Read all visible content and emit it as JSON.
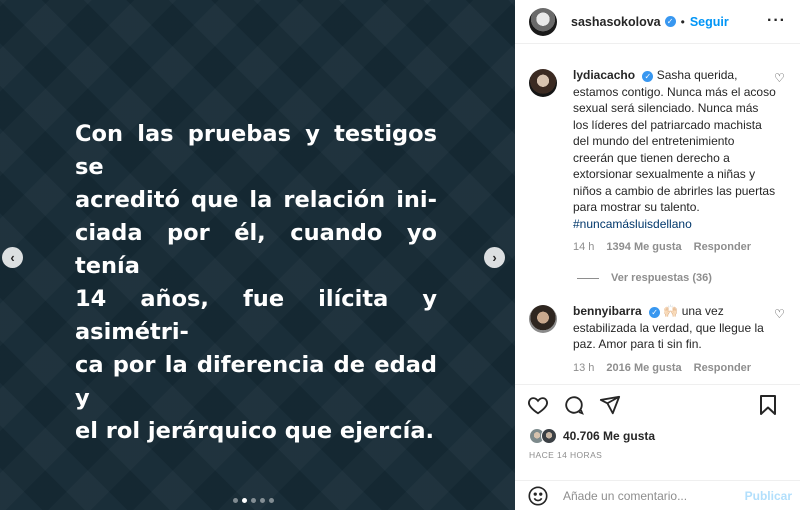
{
  "post": {
    "lines": [
      "Con las pruebas y testigos se",
      "acreditó que la relación ini-",
      "ciada por él, cuando yo tenía",
      "14 años, fue ilícita y asimétri-",
      "ca por la diferencia de edad y",
      "el rol jerárquico que ejercía."
    ],
    "prev_icon": "chevron-left-icon",
    "next_icon": "chevron-right-icon",
    "dots_total": 5,
    "dots_active_index": 1
  },
  "header": {
    "username": "sashasokolova",
    "separator": "•",
    "follow_label": "Seguir",
    "more_label": "···"
  },
  "comments": [
    {
      "username": "lydiacacho",
      "text": "Sasha querida, estamos contigo. Nunca más el acoso sexual será silenciado. Nunca más los líderes del patriarcado machista del mundo del entretenimiento creerán que tienen derecho a extorsionar sexualmente a niñas y niños a cambio de abrirles las puertas para mostrar su talento.",
      "hashtag": "#nuncamásluisdellano",
      "time": "14 h",
      "likes": "1394 Me gusta",
      "reply": "Responder",
      "view_replies": "Ver respuestas (36)"
    },
    {
      "username": "bennyibarra",
      "emoji": "🙌🏻",
      "text": "una vez estabilizada la verdad, que llegue la paz. Amor para ti sin fin.",
      "time": "13 h",
      "likes": "2016 Me gusta",
      "reply": "Responder"
    }
  ],
  "likes": {
    "count_text": "40.706 Me gusta",
    "time_ago": "HACE 14 HORAS"
  },
  "composer": {
    "placeholder": "Añade un comentario...",
    "publish_label": "Publicar"
  },
  "colors": {
    "post_background": "#162a35",
    "accent": "#0095f6",
    "publish_disabled": "#b2dffc",
    "verified": "#3897f0"
  }
}
